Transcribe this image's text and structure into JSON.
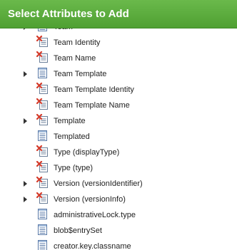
{
  "dialog": {
    "title": "Select Attributes to Add"
  },
  "attributes": [
    {
      "label": "Team",
      "icon": "table-icon",
      "expandable": true
    },
    {
      "label": "Team Identity",
      "icon": "computed-field-icon",
      "expandable": false
    },
    {
      "label": "Team Name",
      "icon": "computed-field-icon",
      "expandable": false
    },
    {
      "label": "Team Template",
      "icon": "table-icon",
      "expandable": true
    },
    {
      "label": "Team Template Identity",
      "icon": "computed-field-icon",
      "expandable": false
    },
    {
      "label": "Team Template Name",
      "icon": "computed-field-icon",
      "expandable": false
    },
    {
      "label": "Template",
      "icon": "computed-field-icon",
      "expandable": true
    },
    {
      "label": "Templated",
      "icon": "table-icon",
      "expandable": false
    },
    {
      "label": "Type (displayType)",
      "icon": "computed-field-icon",
      "expandable": false
    },
    {
      "label": "Type (type)",
      "icon": "computed-field-icon",
      "expandable": false
    },
    {
      "label": "Version (versionIdentifier)",
      "icon": "computed-field-icon",
      "expandable": true
    },
    {
      "label": "Version (versionInfo)",
      "icon": "computed-field-icon",
      "expandable": true
    },
    {
      "label": "administrativeLock.type",
      "icon": "table-icon",
      "expandable": false
    },
    {
      "label": "blob$entrySet",
      "icon": "table-icon",
      "expandable": false
    },
    {
      "label": "creator.key.classname",
      "icon": "table-icon",
      "expandable": false
    }
  ],
  "colors": {
    "title_bar": "#57a83a",
    "title_text": "#ffffff"
  }
}
